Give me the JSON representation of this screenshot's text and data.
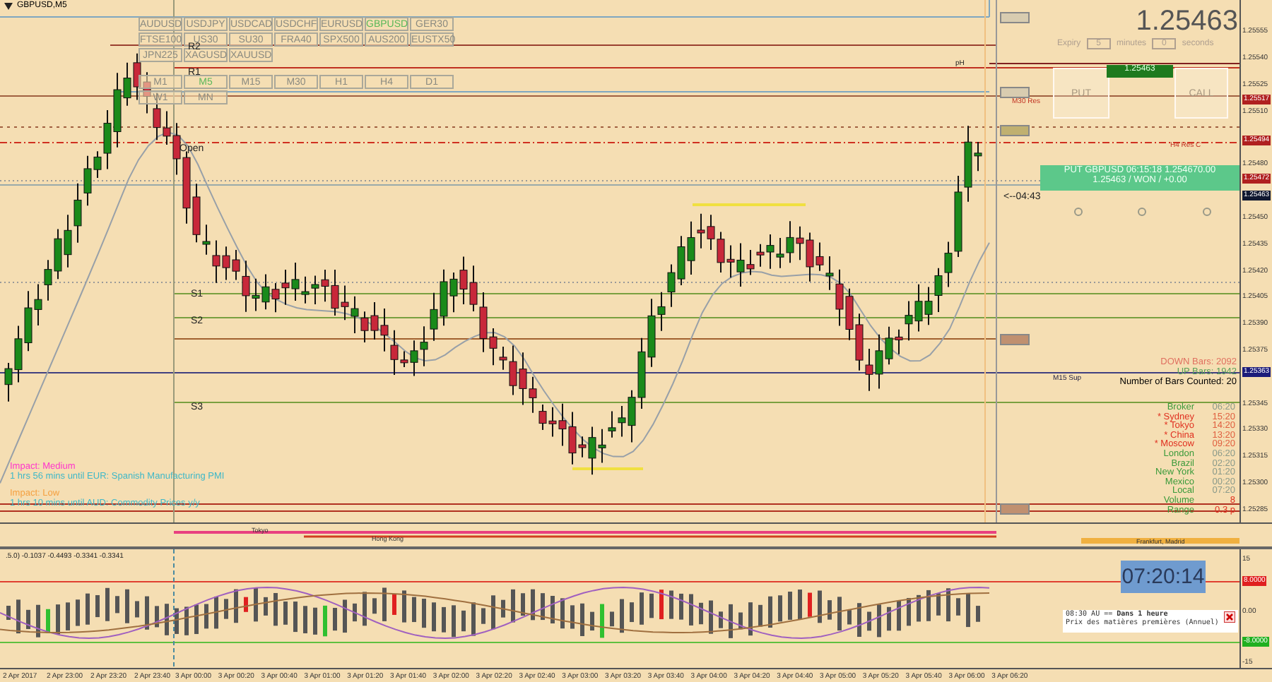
{
  "chart_window": {
    "title": "GBPUSD,M5"
  },
  "symbols": [
    {
      "label": "AUDUSD",
      "selected": false
    },
    {
      "label": "USDJPY",
      "selected": false
    },
    {
      "label": "USDCAD",
      "selected": false
    },
    {
      "label": "USDCHF",
      "selected": false
    },
    {
      "label": "EURUSD",
      "selected": false
    },
    {
      "label": "GBPUSD",
      "selected": true
    },
    {
      "label": "GER30",
      "selected": false
    },
    {
      "label": "FTSE100",
      "selected": false
    },
    {
      "label": "US30",
      "selected": false
    },
    {
      "label": "SU30",
      "selected": false
    },
    {
      "label": "FRA40",
      "selected": false
    },
    {
      "label": "SPX500",
      "selected": false
    },
    {
      "label": "AUS200",
      "selected": false
    },
    {
      "label": "EUSTX50",
      "selected": false
    },
    {
      "label": "JPN225",
      "selected": false
    },
    {
      "label": "XAGUSD",
      "selected": false
    },
    {
      "label": "XAUUSD",
      "selected": false
    }
  ],
  "timeframes": [
    {
      "label": "M1",
      "selected": false
    },
    {
      "label": "M5",
      "selected": true
    },
    {
      "label": "M15",
      "selected": false
    },
    {
      "label": "M30",
      "selected": false
    },
    {
      "label": "H1",
      "selected": false
    },
    {
      "label": "H4",
      "selected": false
    },
    {
      "label": "D1",
      "selected": false
    },
    {
      "label": "W1",
      "selected": false
    },
    {
      "label": "MN",
      "selected": false
    }
  ],
  "pivot_labels": [
    "R2",
    "R1",
    "Open",
    "S1",
    "S2",
    "S3"
  ],
  "line_labels": [
    {
      "label": "pH",
      "kind": "marker"
    },
    {
      "label": "M30 Res",
      "kind": "resistance"
    },
    {
      "label": "H4 Res C",
      "kind": "resistance"
    },
    {
      "label": "M15 Sup",
      "kind": "support"
    }
  ],
  "trade_panel": {
    "price": "1.25463",
    "expiry_label": "Expiry",
    "minutes": "5",
    "minutes_label": "minutes",
    "seconds": "0",
    "seconds_label": "seconds",
    "current_price": "1.25463",
    "put_label": "PUT",
    "call_label": "CALL"
  },
  "trade_result": {
    "line_1": "PUT GBPUSD 06:15:18 1.254670.00",
    "line_2": "1.25463 / WON / +0.00"
  },
  "countdown": "<--04:43",
  "bar_stats": {
    "down": "DOWN Bars: 2092",
    "up": "UP Bars: 1942",
    "counted": "Number of Bars Counted: 20"
  },
  "market_clocks": [
    {
      "name": "Broker",
      "time": "06:20",
      "kind": "clock",
      "highlighted": false
    },
    {
      "name": "* Sydney",
      "time": "15:20",
      "kind": "clock",
      "highlighted": true
    },
    {
      "name": "* Tokyo",
      "time": "14:20",
      "kind": "clock",
      "highlighted": true
    },
    {
      "name": "* China",
      "time": "13:20",
      "kind": "clock",
      "highlighted": true
    },
    {
      "name": "* Moscow",
      "time": "09:20",
      "kind": "clock",
      "highlighted": true
    },
    {
      "name": "London",
      "time": "06:20",
      "kind": "clock",
      "highlighted": false
    },
    {
      "name": "Brazil",
      "time": "02:20",
      "kind": "clock",
      "highlighted": false
    },
    {
      "name": "New York",
      "time": "01:20",
      "kind": "clock",
      "highlighted": false
    },
    {
      "name": "Mexico",
      "time": "00:20",
      "kind": "clock",
      "highlighted": false
    },
    {
      "name": "Local",
      "time": "07:20",
      "kind": "clock",
      "highlighted": false
    },
    {
      "name": "Volume",
      "time": "8",
      "kind": "stat"
    },
    {
      "name": "Range",
      "time": "0.3 p",
      "kind": "stat"
    }
  ],
  "news": [
    {
      "impact": "Impact: Medium",
      "color": "#ff33cc",
      "text": "1 hrs 56 mins until EUR: Spanish Manufacturing PMI"
    },
    {
      "impact": "Impact: Low",
      "color": "#f5a040",
      "text": "1 hrs 10 mins until AUD: Commodity Prices y/y"
    }
  ],
  "sessions_strip": [
    {
      "label": "Tokyo"
    },
    {
      "label": "Hong Kong"
    },
    {
      "label": "Frankfurt, Madrid"
    }
  ],
  "price_axis": [
    {
      "label": "1.25555",
      "kind": "tick"
    },
    {
      "label": "1.25540",
      "kind": "tick"
    },
    {
      "label": "1.25525",
      "kind": "tick"
    },
    {
      "label": "1.25517",
      "kind": "tag",
      "color": "#b02020"
    },
    {
      "label": "1.25510",
      "kind": "tick"
    },
    {
      "label": "1.25494",
      "kind": "tag",
      "color": "#b02020"
    },
    {
      "label": "1.25480",
      "kind": "tick"
    },
    {
      "label": "1.25472",
      "kind": "tag",
      "color": "#b02020"
    },
    {
      "label": "1.25463",
      "kind": "tag",
      "color": "#101830"
    },
    {
      "label": "1.25450",
      "kind": "tick"
    },
    {
      "label": "1.25435",
      "kind": "tick"
    },
    {
      "label": "1.25420",
      "kind": "tick"
    },
    {
      "label": "1.25405",
      "kind": "tick"
    },
    {
      "label": "1.25390",
      "kind": "tick"
    },
    {
      "label": "1.25375",
      "kind": "tick"
    },
    {
      "label": "1.25363",
      "kind": "tag",
      "color": "#1c1c7a"
    },
    {
      "label": "1.25345",
      "kind": "tick"
    },
    {
      "label": "1.25330",
      "kind": "tick"
    },
    {
      "label": "1.25315",
      "kind": "tick"
    },
    {
      "label": "1.25300",
      "kind": "tick"
    },
    {
      "label": "1.25285",
      "kind": "tick"
    }
  ],
  "indicator": {
    "legend": ".5.0) -0.1037 -0.4493 -0.3341 -0.3341",
    "clock": "07:20:14",
    "axis": [
      {
        "label": "15",
        "kind": "tick"
      },
      {
        "label": "8.0000",
        "kind": "tag",
        "color": "#e02020"
      },
      {
        "label": "0.00",
        "kind": "tick"
      },
      {
        "label": "-8.0000",
        "kind": "tag",
        "color": "#20b020"
      },
      {
        "label": "-15",
        "kind": "tick"
      }
    ],
    "alert": {
      "time": "08:30 AU ==",
      "headline": "Dans 1 heure",
      "detail": "Prix des matières premières (Annuel)"
    }
  },
  "time_axis": [
    "2 Apr 2017",
    "2 Apr 23:00",
    "2 Apr 23:20",
    "2 Apr 23:40",
    "3 Apr 00:00",
    "3 Apr 00:20",
    "3 Apr 00:40",
    "3 Apr 01:00",
    "3 Apr 01:20",
    "3 Apr 01:40",
    "3 Apr 02:00",
    "3 Apr 02:20",
    "3 Apr 02:40",
    "3 Apr 03:00",
    "3 Apr 03:20",
    "3 Apr 03:40",
    "3 Apr 04:00",
    "3 Apr 04:20",
    "3 Apr 04:40",
    "3 Apr 05:00",
    "3 Apr 05:20",
    "3 Apr 05:40",
    "3 Apr 06:00",
    "3 Apr 06:20"
  ]
}
